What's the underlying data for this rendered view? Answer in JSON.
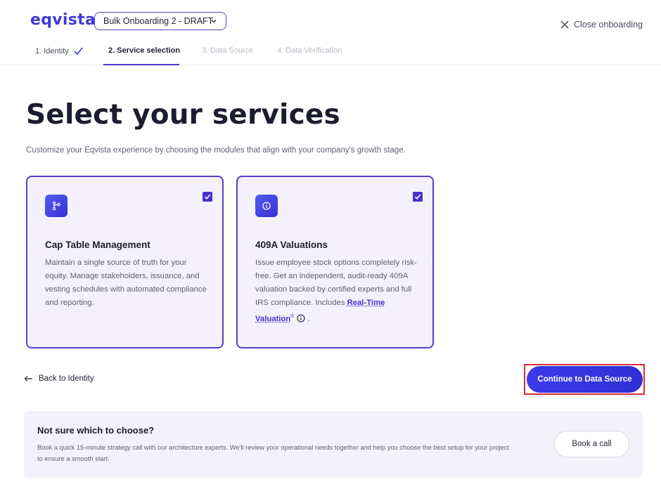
{
  "header": {
    "logo": "eqvista",
    "project_select": {
      "value": "Bulk Onboarding 2 - DRAFT"
    },
    "close_label": "Close onboarding"
  },
  "steps": [
    {
      "label": "1. Identity",
      "state": "done"
    },
    {
      "label": "2. Service selection",
      "state": "active"
    },
    {
      "label": "3. Data Source",
      "state": "upcoming"
    },
    {
      "label": "4. Data Verification",
      "state": "upcoming"
    }
  ],
  "main": {
    "title": "Select your services",
    "subtitle": "Customize your Eqvista experience by choosing the modules that align with your company's growth stage.",
    "cards": [
      {
        "icon": "branch-icon",
        "checked": true,
        "title": "Cap Table Management",
        "description": "Maintain a single source of truth for your equity. Manage stakeholders, issuance, and vesting schedules with automated compliance and reporting."
      },
      {
        "icon": "info-circle-icon",
        "checked": true,
        "title": "409A Valuations",
        "description": "Issue employee stock options completely risk-free. Get an independent, audit-ready 409A valuation backed by certified experts and full IRS compliance. Includes ",
        "link_label": "Real-Time Valuation",
        "link_mark": "®",
        "suffix": "."
      }
    ]
  },
  "nav": {
    "back_label": "Back to Identity",
    "continue_label": "Continue to Data Source"
  },
  "help": {
    "title": "Not sure which to choose?",
    "text": "Book a quick 15-minute strategy call with our architecture experts. We'll review your operational needs together and help you choose the best setup for your project to ensure a smooth start.",
    "button_label": "Book a call"
  },
  "colors": {
    "accent": "#4a2fd0",
    "card_bg": "#f4f1fd",
    "highlight": "#d62f3b"
  }
}
